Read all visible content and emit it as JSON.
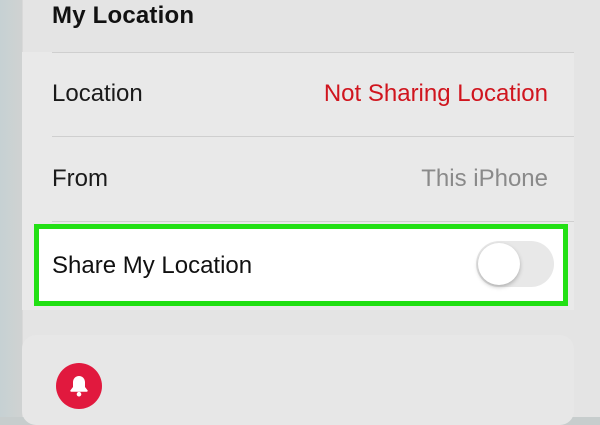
{
  "section": {
    "title": "My Location"
  },
  "rows": [
    {
      "label": "Location",
      "value": "Not Sharing Location",
      "value_color": "#d0151e"
    },
    {
      "label": "From",
      "value": "This iPhone",
      "value_color": "#8a8a8a"
    }
  ],
  "share": {
    "label": "Share My Location",
    "toggle_on": false,
    "highlight_color": "#22e014"
  },
  "notifications": {
    "icon": "bell-icon",
    "icon_bg": "#e1193e"
  }
}
